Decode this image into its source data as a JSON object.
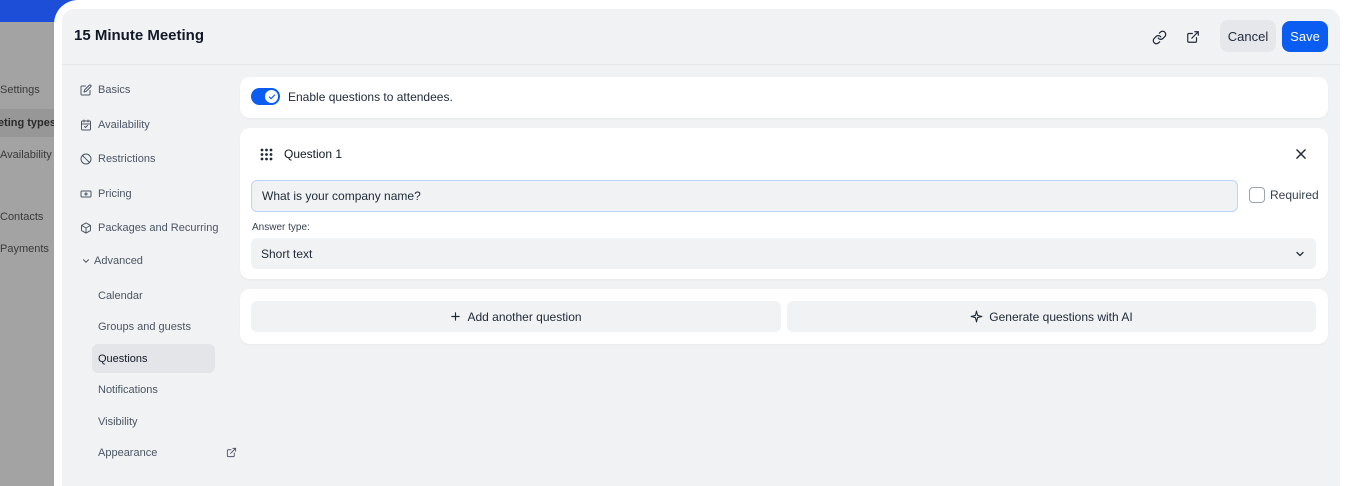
{
  "background_app": {
    "sidebar": [
      {
        "label": "Settings",
        "active": false
      },
      {
        "label": "Meeting types",
        "active": true
      },
      {
        "label": "Availability",
        "active": false
      },
      {
        "label": "Contacts",
        "active": false
      },
      {
        "label": "Payments",
        "active": false
      }
    ],
    "colors": {
      "topbar": "#1d4ed8"
    }
  },
  "header": {
    "title": "15 Minute Meeting",
    "link_icon": "link-icon",
    "external_icon": "external-link-icon",
    "cancel_label": "Cancel",
    "save_label": "Save"
  },
  "nav": {
    "items": [
      {
        "label": "Basics",
        "icon": "edit-icon"
      },
      {
        "label": "Availability",
        "icon": "calendar-icon"
      },
      {
        "label": "Restrictions",
        "icon": "ban-icon"
      },
      {
        "label": "Pricing",
        "icon": "money-icon"
      },
      {
        "label": "Packages and Recurring",
        "icon": "package-icon"
      }
    ],
    "advanced_label": "Advanced",
    "advanced_sub": [
      {
        "label": "Calendar",
        "active": false
      },
      {
        "label": "Groups and guests",
        "active": false
      },
      {
        "label": "Questions",
        "active": true
      },
      {
        "label": "Notifications",
        "active": false
      },
      {
        "label": "Visibility",
        "active": false
      },
      {
        "label": "Appearance",
        "active": false,
        "external": true
      }
    ]
  },
  "questions": {
    "enable_label": "Enable questions to attendees.",
    "enabled": true,
    "question_title": "Question 1",
    "question_value": "What is your company name?",
    "required_label": "Required",
    "required_checked": false,
    "answer_type_label": "Answer type:",
    "answer_type_value": "Short text",
    "add_question_label": "Add another question",
    "generate_label": "Generate questions with AI"
  },
  "colors": {
    "accent": "#0b5cf0",
    "panel_bg": "#f1f2f4",
    "card_bg": "#ffffff"
  }
}
